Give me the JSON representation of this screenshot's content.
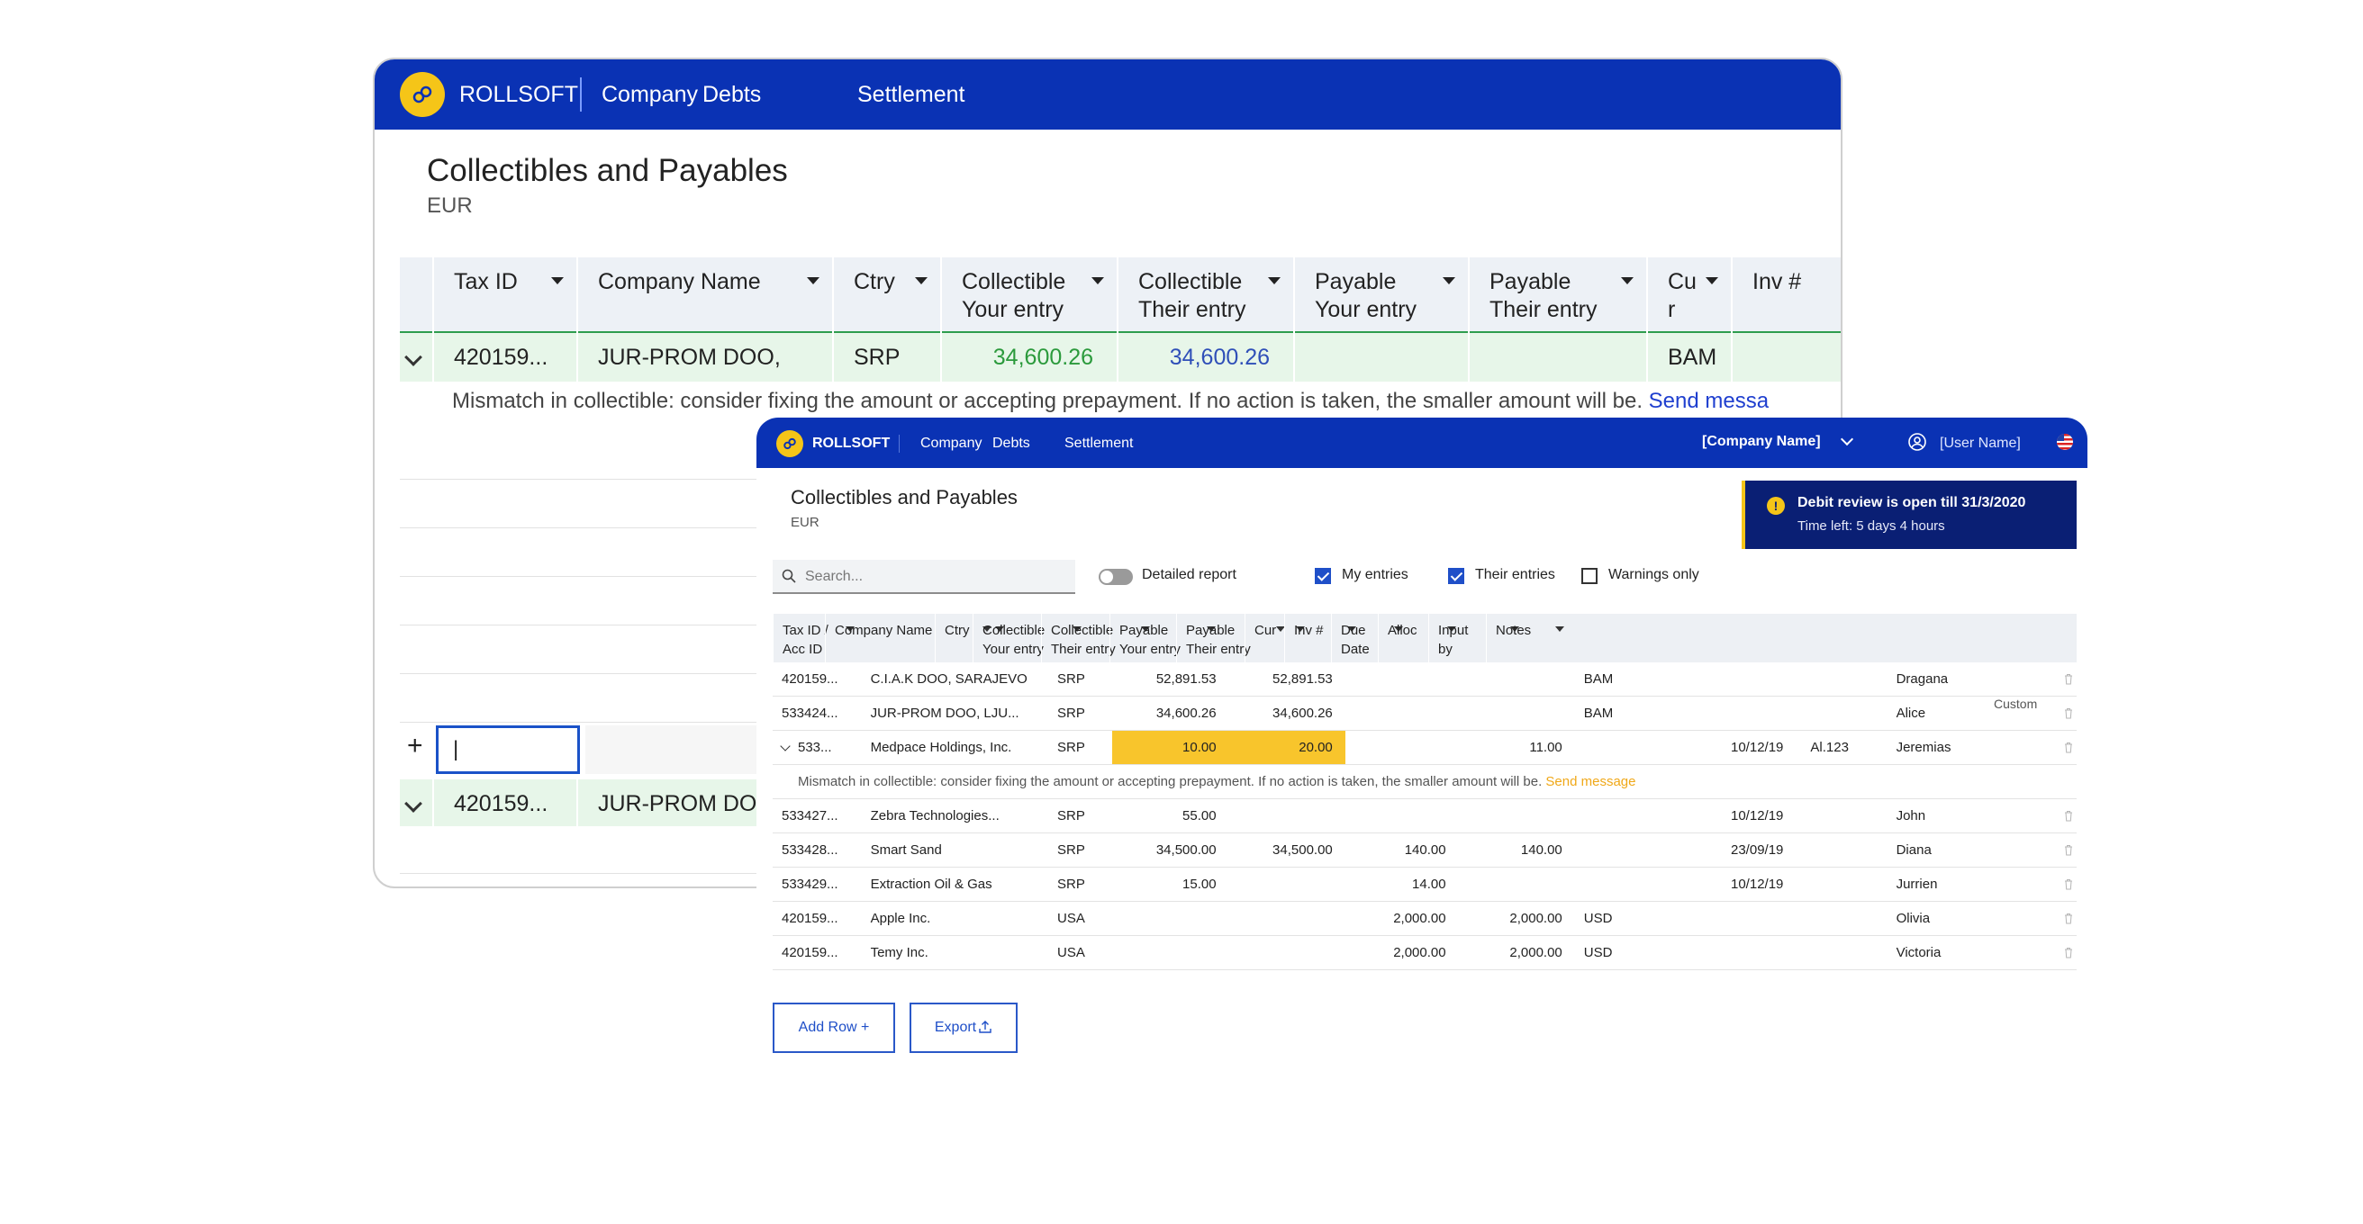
{
  "brand": "ROLLSOFT",
  "nav": [
    "Company",
    "Debts",
    "Settlement"
  ],
  "page": {
    "title": "Collectibles and Payables",
    "currency": "EUR"
  },
  "back": {
    "columns": [
      "Tax ID",
      "Company Name",
      "Ctry",
      "Collectible\nYour entry",
      "Collectible\nTheir entry",
      "Payable\nYour entry",
      "Payable\nTheir entry",
      "Cu\nr",
      "Inv #"
    ],
    "row1": {
      "tax_id": "420159...",
      "company": "JUR-PROM DOO,",
      "ctry": "SRP",
      "coll_your": "34,600.26",
      "coll_their": "34,600.26",
      "cur": "BAM"
    },
    "message": "Mismatch in collectible: consider fixing the amount or accepting prepayment. If no action is taken, the smaller amount will be.",
    "message_link": "Send messa",
    "input_value": "|",
    "plus": "+",
    "row2": {
      "tax_id": "420159...",
      "company": "JUR-PROM DO"
    }
  },
  "front": {
    "company_name": "[Company Name]",
    "user_name": "[User Name]",
    "notice": {
      "title": "Debit review is open till 31/3/2020",
      "time_left": "Time left: 5 days 4 hours"
    },
    "search_placeholder": "Search...",
    "toggle_label": "Detailed report",
    "filters": [
      {
        "label": "My entries",
        "checked": true
      },
      {
        "label": "Their entries",
        "checked": true
      },
      {
        "label": "Warnings only",
        "checked": false
      }
    ],
    "columns": [
      "Tax ID /\nAcc ID",
      "Company Name",
      "Ctry",
      "Collectible\nYour entry",
      "Collectible\nTheir entry",
      "Payable\nYour entry",
      "Payable\nTheir entry",
      "Cur",
      "Inv #",
      "Due\nDate",
      "Alloc",
      "Input\nby",
      "Notes"
    ],
    "rows": [
      [
        "420159...",
        "C.I.A.K DOO, SARAJEVO",
        "SRP",
        "52,891.53",
        "52,891.53",
        "",
        "",
        "BAM",
        "",
        "",
        "",
        "Dragana"
      ],
      [
        "533424...",
        "JUR-PROM DOO, LJU...",
        "SRP",
        "34,600.26",
        "34,600.26",
        "",
        "",
        "BAM",
        "",
        "",
        "",
        "Alice"
      ],
      [
        "533...",
        "Medpace Holdings, Inc.",
        "SRP",
        "10.00",
        "20.00",
        "",
        "11.00",
        "",
        "",
        "10/12/19",
        "Al.123",
        "Jeremias"
      ],
      [
        "533427...",
        "Zebra Technologies...",
        "SRP",
        "55.00",
        "",
        "",
        "",
        "",
        "",
        "10/12/19",
        "",
        "John"
      ],
      [
        "533428...",
        "Smart Sand",
        "SRP",
        "34,500.00",
        "34,500.00",
        "140.00",
        "140.00",
        "",
        "",
        "23/09/19",
        "",
        "Diana"
      ],
      [
        "533429...",
        "Extraction Oil & Gas",
        "SRP",
        "15.00",
        "",
        "14.00",
        "",
        "",
        "",
        "10/12/19",
        "",
        "Jurrien"
      ],
      [
        "420159...",
        "Apple Inc.",
        "USA",
        "",
        "",
        "2,000.00",
        "2,000.00",
        "USD",
        "",
        "",
        "",
        "Olivia"
      ],
      [
        "420159...",
        "Temy Inc.",
        "USA",
        "",
        "",
        "2,000.00",
        "2,000.00",
        "USD",
        "",
        "",
        "",
        "Victoria"
      ]
    ],
    "message": "Mismatch in collectible: consider fixing the amount or accepting prepayment. If no action is taken, the smaller amount will be.",
    "message_link": "Send message",
    "custom_tip": "Custom",
    "add_row_label": "Add Row +",
    "export_label": "Export",
    "colors": {
      "primary": "#0a32b4",
      "accent": "#f5c518",
      "highlight": "#f8c52c",
      "link": "#f0a818"
    }
  }
}
